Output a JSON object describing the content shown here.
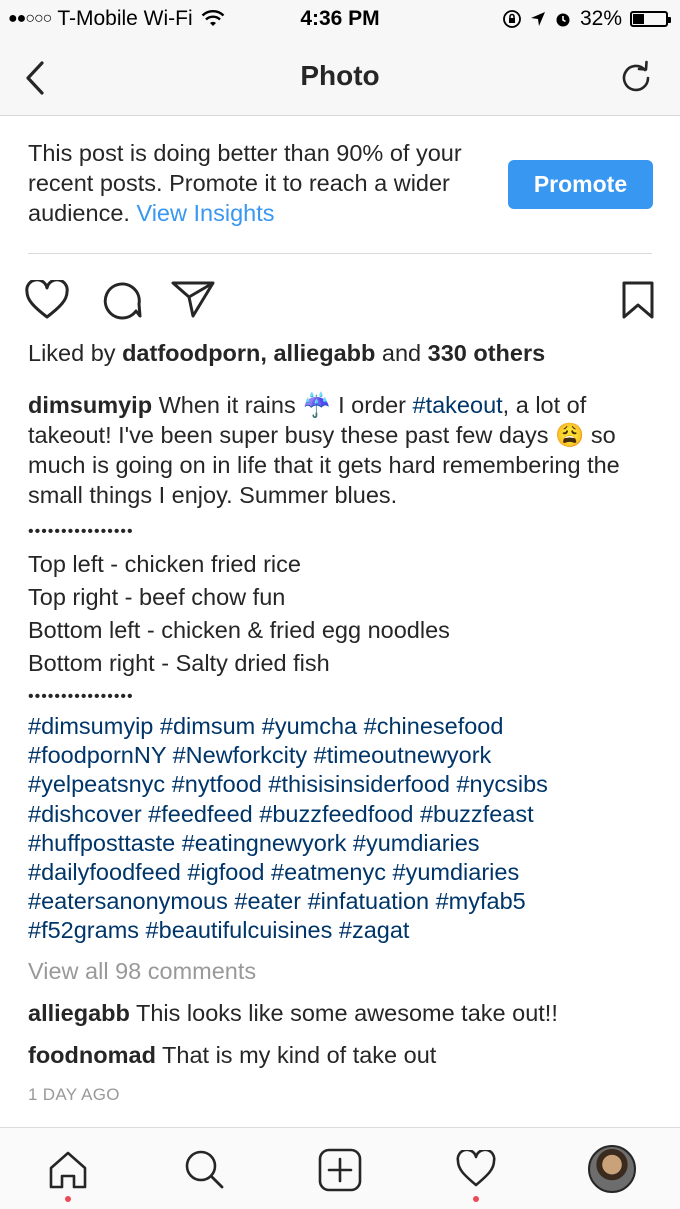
{
  "status_bar": {
    "carrier": "T-Mobile Wi-Fi",
    "time": "4:36 PM",
    "battery_percent": "32%",
    "battery_level": 0.32
  },
  "nav": {
    "title": "Photo",
    "back_icon": "chevron-left-icon",
    "refresh_icon": "refresh-icon"
  },
  "promo": {
    "text": "This post is doing better than 90% of your recent posts. Promote it to reach a wider audience.",
    "link": "View Insights",
    "button": "Promote",
    "accent": "#3897f0"
  },
  "post": {
    "likes": {
      "prefix": "Liked by",
      "user1": "datfoodporn",
      "user2": "alliegabb",
      "and": "and",
      "others": "330 others"
    },
    "caption": {
      "user": "dimsumyip",
      "part1": "When it rains",
      "emoji1": "☔",
      "part2": "I order",
      "tag": "#takeout",
      "part3": ", a lot of takeout! I've been super busy these past few days",
      "emoji2": "😩",
      "part4": "so much is going on in life that it gets hard remembering the small things I enjoy. Summer blues."
    },
    "separator": "••••••••••••••••",
    "items": [
      "Top left - chicken fried rice",
      "Top right - beef chow fun",
      "Bottom left - chicken & fried egg noodles",
      "Bottom right - Salty dried fish"
    ],
    "hashtags": [
      "#dimsumyip #dimsum #yumcha #chinesefood",
      "#foodpornNY #Newforkcity #timeoutnewyork",
      "#yelpeatsnyc #nytfood #thisisinsiderfood  #nycsibs",
      "#dishcover #feedfeed #buzzfeedfood #buzzfeast",
      "#huffposttaste #eatingnewyork #yumdiaries",
      "#dailyfoodfeed #igfood #eatmenyc #yumdiaries",
      "#eatersanonymous #eater #infatuation #myfab5",
      "#f52grams #beautifulcuisines #zagat"
    ],
    "view_all": "View all 98 comments",
    "comments": [
      {
        "user": "alliegabb",
        "text": "This looks like some awesome take out!!"
      },
      {
        "user": "foodnomad",
        "text": "That is my kind of take out"
      }
    ],
    "time_ago": "1 DAY AGO"
  },
  "tabbar": {
    "icons": [
      "home-icon",
      "search-icon",
      "add-post-icon",
      "activity-heart-icon",
      "profile-avatar"
    ],
    "notification_color": "#ed4956"
  }
}
